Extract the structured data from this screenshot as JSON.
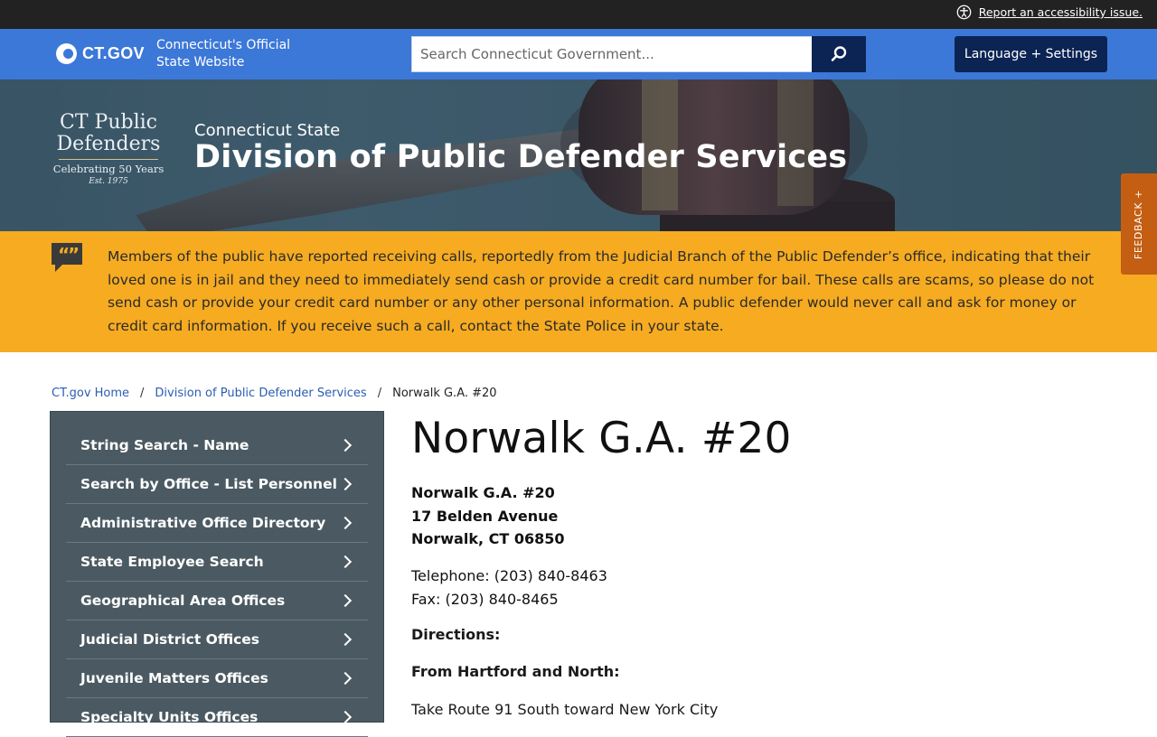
{
  "utility": {
    "accessibility_link": "Report an accessibility issue."
  },
  "ctgov": {
    "logo_text": "CT.GOV",
    "tagline_line1": "Connecticut's Official",
    "tagline_line2": "State Website",
    "search_placeholder": "Search Connecticut Government...",
    "language_button": "Language + Settings"
  },
  "hero": {
    "logo_line1": "CT Public",
    "logo_line2": "Defenders",
    "logo_line3": "Celebrating 50 Years",
    "logo_line4": "Est. 1975",
    "kicker": "Connecticut State",
    "title": "Division of Public Defender Services"
  },
  "feedback_tab": "FEEDBACK +",
  "alert": {
    "text": "Members of the public have reported receiving calls, reportedly from the Judicial Branch of the Public Defender’s office, indicating that their loved one is in jail and they need to immediately send cash or provide a credit card number for bail. These calls are scams, so please do not send cash or provide your credit card number or any other personal information. A public defender would never call and ask for money or credit card information. If you receive such a call, contact the State Police in your state."
  },
  "breadcrumb": {
    "home": "CT.gov Home",
    "division": "Division of Public Defender Services",
    "current": "Norwalk G.A. #20",
    "separator": "/"
  },
  "sidenav": {
    "items": [
      {
        "label": "String Search - Name"
      },
      {
        "label": "Search by Office - List Personnel"
      },
      {
        "label": "Administrative Office Directory"
      },
      {
        "label": "State Employee Search"
      },
      {
        "label": "Geographical Area Offices"
      },
      {
        "label": "Judicial District Offices"
      },
      {
        "label": "Juvenile Matters Offices"
      },
      {
        "label": "Specialty Units Offices"
      }
    ]
  },
  "main": {
    "title": "Norwalk G.A. #20",
    "address_line1": "Norwalk G.A. #20",
    "address_line2": "17 Belden Avenue",
    "address_line3": "Norwalk, CT 06850",
    "telephone": "Telephone: (203) 840-8463",
    "fax": "Fax: (203) 840-8465",
    "directions_heading": "Directions:",
    "from_heading": "From Hartford and North:",
    "route_line": "Take Route 91 South toward New York City"
  },
  "colors": {
    "ctgov_blue": "#3c78d8",
    "navy": "#0b2454",
    "alert_yellow": "#f6ab21",
    "sidenav_gray": "#4b5a62",
    "feedback_orange": "#c45e12"
  }
}
